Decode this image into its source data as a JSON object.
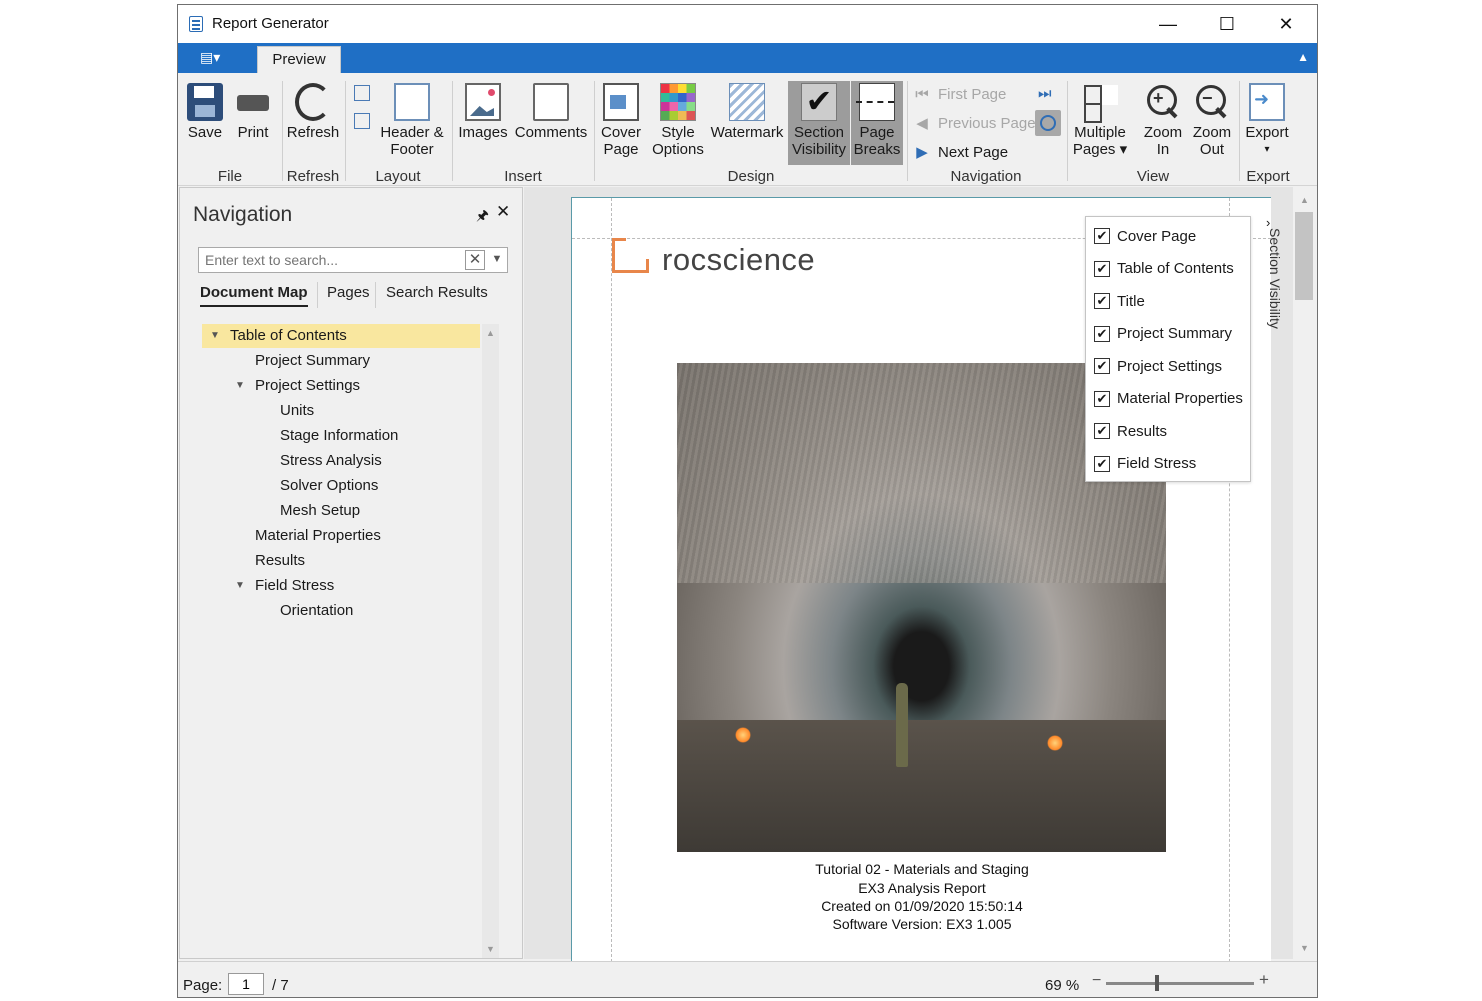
{
  "window": {
    "title": "Report Generator",
    "minimize": "—",
    "maximize": "☐",
    "close": "✕"
  },
  "ribbon": {
    "file_menu_icon": "▤▾",
    "tab": "Preview",
    "collapse": "▲",
    "buttons": {
      "save": "Save",
      "print": "Print",
      "refresh": "Refresh",
      "header_footer_1": "Header &",
      "header_footer_2": "Footer",
      "images": "Images",
      "comments": "Comments",
      "cover_1": "Cover",
      "cover_2": "Page",
      "style_1": "Style",
      "style_2": "Options",
      "watermark": "Watermark",
      "section_vis_1": "Section",
      "section_vis_2": "Visibility",
      "page_breaks_1": "Page",
      "page_breaks_2": "Breaks",
      "multiple_1": "Multiple",
      "multiple_2": "Pages ▾",
      "zoom_in_1": "Zoom",
      "zoom_in_2": "In",
      "zoom_out_1": "Zoom",
      "zoom_out_2": "Out",
      "export": "Export",
      "export_arrow": "▾"
    },
    "navigation": {
      "first": "First Page",
      "previous": "Previous Page",
      "next": "Next Page",
      "last_glyph": "⏭",
      "first_glyph": "⏮",
      "prev_glyph": "◀",
      "next_glyph": "▶"
    },
    "groups": {
      "file": "File",
      "refresh": "Refresh",
      "layout": "Layout",
      "insert": "Insert",
      "design": "Design",
      "navigation": "Navigation",
      "view": "View",
      "export": "Export"
    }
  },
  "nav_panel": {
    "title": "Navigation",
    "pin": "🖈",
    "close": "✕",
    "search_placeholder": "Enter text to search...",
    "tabs": [
      "Document Map",
      "Pages",
      "Search Results"
    ],
    "tree": [
      {
        "label": "Table of Contents",
        "level": 0,
        "expanded": true
      },
      {
        "label": "Project Summary",
        "level": 1
      },
      {
        "label": "Project Settings",
        "level": 1,
        "expanded": true
      },
      {
        "label": "Units",
        "level": 2
      },
      {
        "label": "Stage Information",
        "level": 2
      },
      {
        "label": "Stress Analysis",
        "level": 2
      },
      {
        "label": "Solver Options",
        "level": 2
      },
      {
        "label": "Mesh Setup",
        "level": 2
      },
      {
        "label": "Material Properties",
        "level": 1
      },
      {
        "label": "Results",
        "level": 1
      },
      {
        "label": "Field Stress",
        "level": 1,
        "expanded": true
      },
      {
        "label": "Orientation",
        "level": 2
      }
    ]
  },
  "document": {
    "logo": "rocscience",
    "caption": [
      "Tutorial 02 - Materials and Staging",
      "EX3 Analysis Report",
      "Created on 01/09/2020 15:50:14",
      "Software Version: EX3 1.005"
    ]
  },
  "section_visibility": {
    "side_label": "Section Visibility",
    "side_arrow": "›",
    "items": [
      {
        "label": "Cover Page",
        "checked": true
      },
      {
        "label": "Table of Contents",
        "checked": true
      },
      {
        "label": "Title",
        "checked": true
      },
      {
        "label": "Project Summary",
        "checked": true
      },
      {
        "label": "Project Settings",
        "checked": true
      },
      {
        "label": "Material Properties",
        "checked": true
      },
      {
        "label": "Results",
        "checked": true
      },
      {
        "label": "Field Stress",
        "checked": true
      }
    ]
  },
  "status": {
    "page_label": "Page:",
    "page_value": "1",
    "page_total": "/ 7",
    "zoom": "69 %",
    "zoom_minus": "−",
    "zoom_plus": "+"
  },
  "colors": {
    "ribbon_blue": "#1f6fc5",
    "selection": "#f9e79f",
    "logo_orange": "#e8864a"
  }
}
